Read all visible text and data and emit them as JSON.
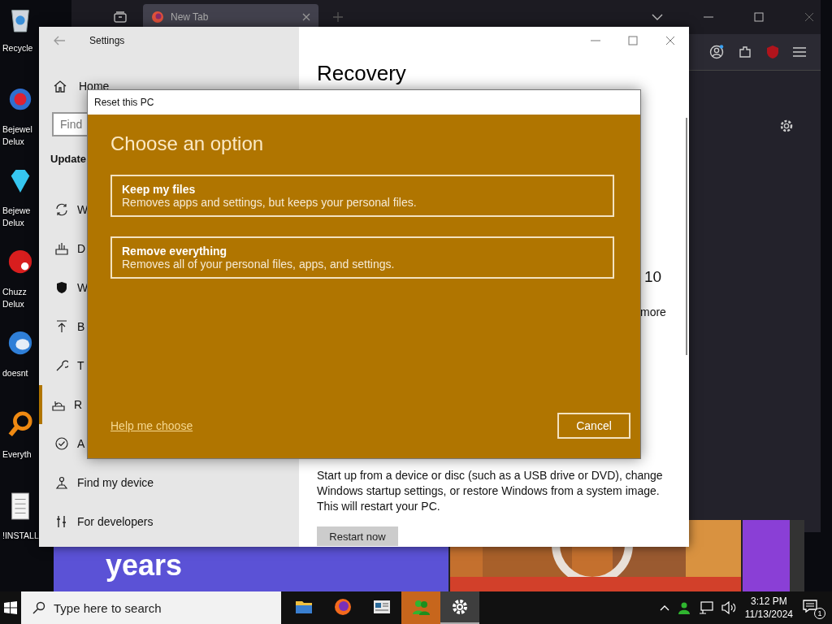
{
  "desktop_icons": [
    {
      "lines": [
        "Recycle"
      ]
    },
    {
      "lines": [
        "Bejewel",
        "Delux"
      ]
    },
    {
      "lines": [
        "Bejewe",
        "Delux"
      ]
    },
    {
      "lines": [
        "Chuzz",
        "Delux"
      ]
    },
    {
      "lines": [
        "doesnt"
      ]
    },
    {
      "lines": [
        "Everyth"
      ]
    },
    {
      "lines": [
        "!INSTALL"
      ]
    }
  ],
  "browser": {
    "tab_title": "New Tab",
    "banner_text": "years"
  },
  "settings": {
    "title": "Settings",
    "home": "Home",
    "search_placeholder": "Find",
    "section_heading": "Update",
    "nav_items": [
      {
        "label": "W",
        "selected": false
      },
      {
        "label": "D",
        "selected": false
      },
      {
        "label": "W",
        "selected": false
      },
      {
        "label": "B",
        "selected": false
      },
      {
        "label": "T",
        "selected": false
      },
      {
        "label": "R",
        "selected": true
      },
      {
        "label": "A",
        "selected": false
      },
      {
        "label": "Find my device",
        "selected": false
      },
      {
        "label": "For developers",
        "selected": false
      }
    ],
    "page_title": "Recovery",
    "fragment_1": "10",
    "fragment_2": "more",
    "advanced_startup_text": "Start up from a device or disc (such as a USB drive or DVD), change Windows startup settings, or restore Windows from a system image. This will restart your PC.",
    "restart_button": "Restart now"
  },
  "dialog": {
    "title": "Reset this PC",
    "heading": "Choose an option",
    "options": [
      {
        "title": "Keep my files",
        "description": "Removes apps and settings, but keeps your personal files."
      },
      {
        "title": "Remove everything",
        "description": "Removes all of your personal files, apps, and settings."
      }
    ],
    "help_link": "Help me choose",
    "cancel_button": "Cancel"
  },
  "taskbar": {
    "search_placeholder": "Type here to search",
    "apps": [
      {
        "selected": false,
        "flashing": false
      },
      {
        "selected": false,
        "flashing": false
      },
      {
        "selected": false,
        "flashing": false
      },
      {
        "selected": false,
        "flashing": true
      },
      {
        "selected": true,
        "flashing": false
      }
    ],
    "time": "3:12 PM",
    "date": "11/13/2024",
    "notification_count": "1"
  }
}
